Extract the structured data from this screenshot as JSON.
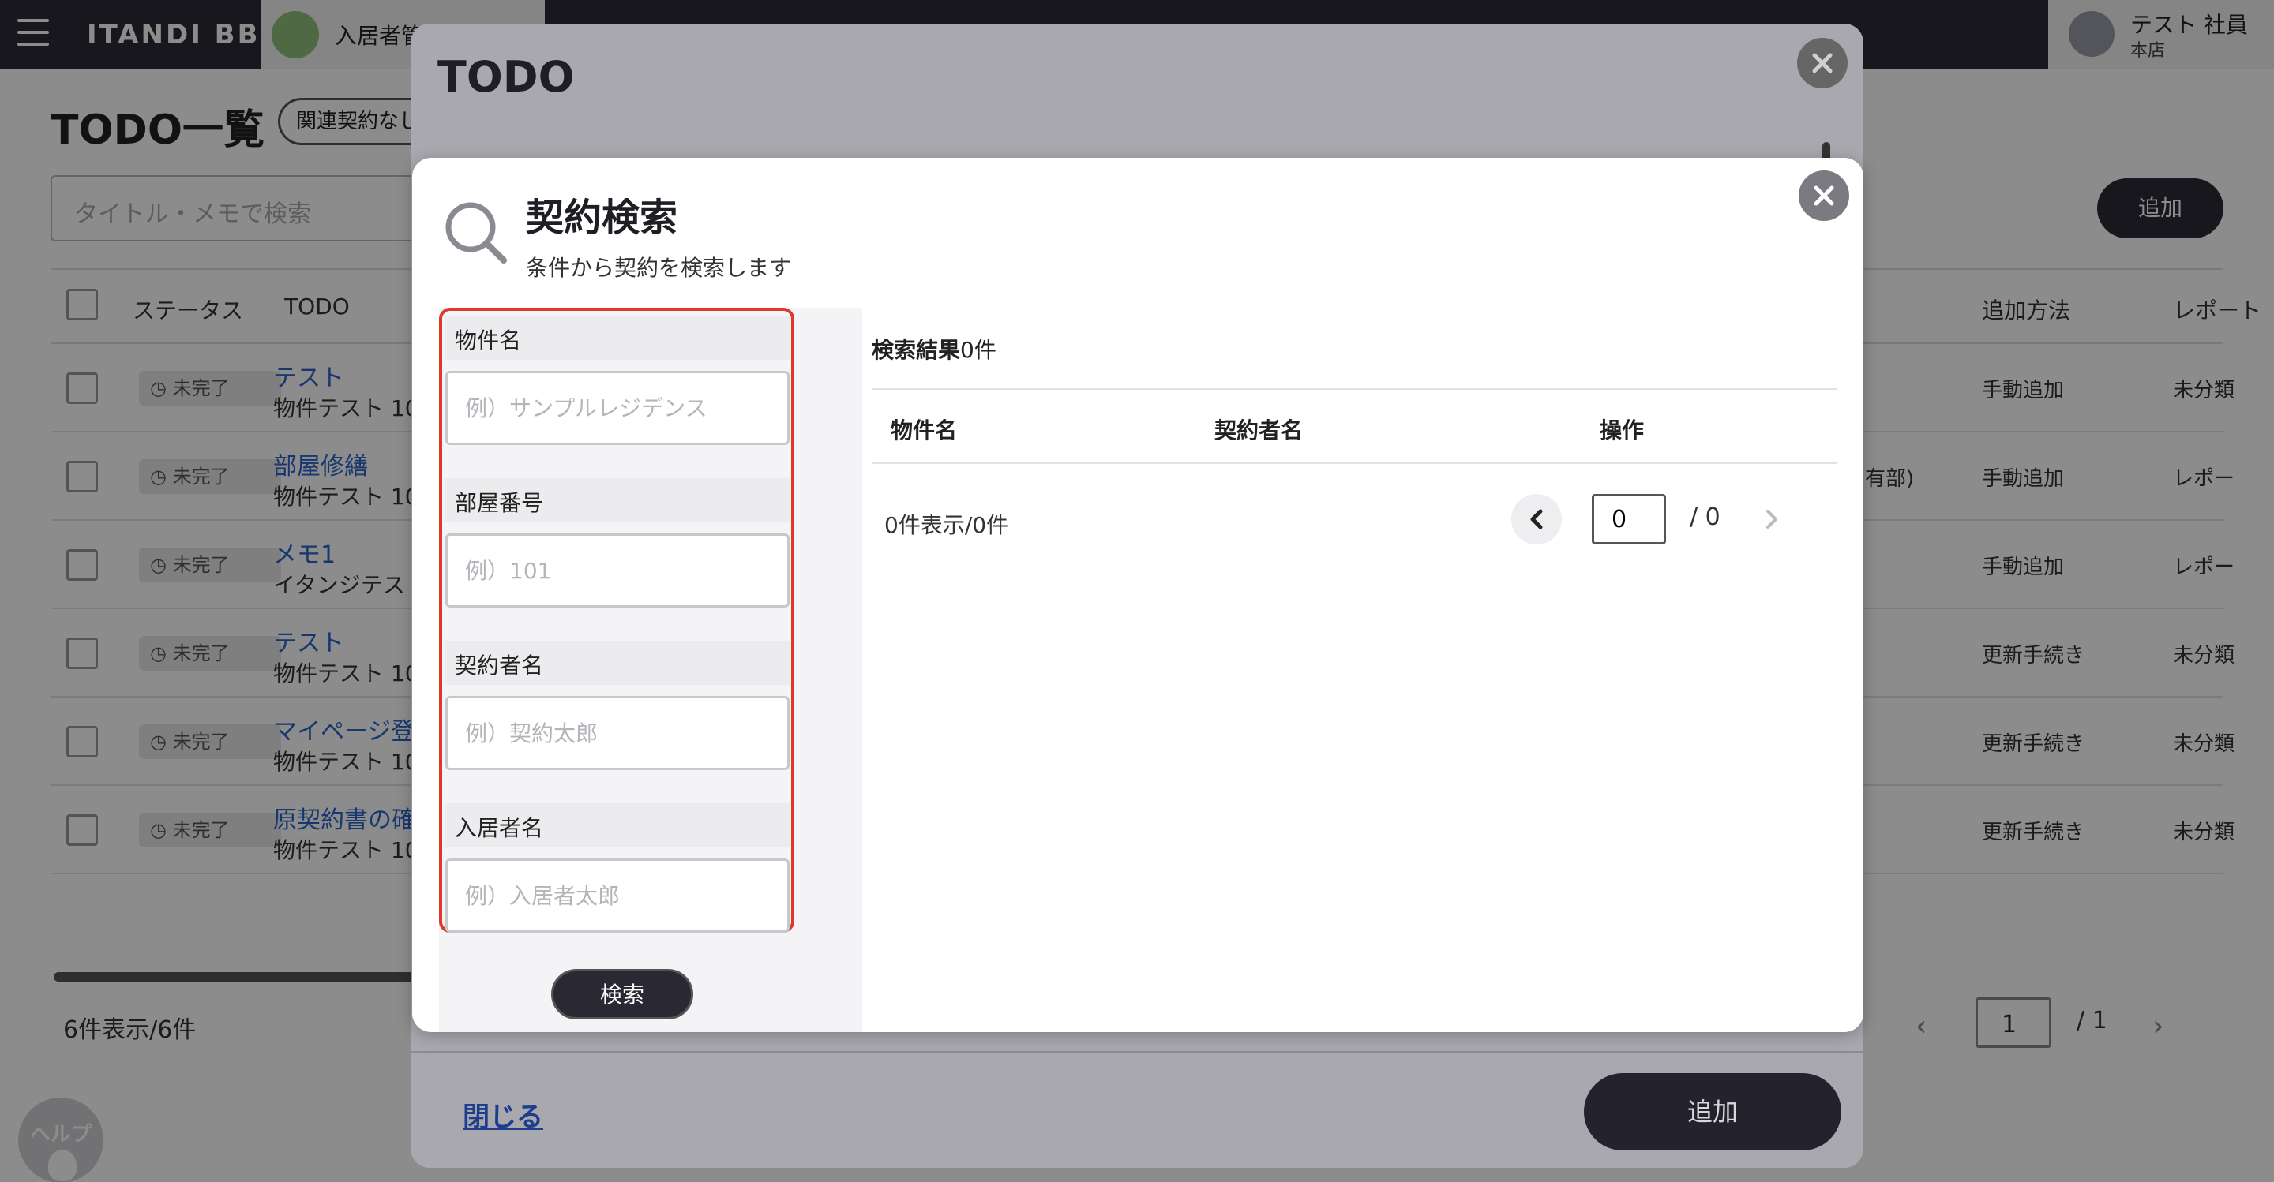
{
  "topbar": {
    "brand": "ITANDI BB",
    "app_tab_label": "入居者管",
    "user": {
      "name": "テスト 社員",
      "branch": "本店"
    }
  },
  "page": {
    "title": "TODO一覧",
    "filter_chip": "関連契約なし",
    "search_placeholder": "タイトル・メモで検索",
    "add_label": "追加",
    "columns": [
      "ステータス",
      "TODO",
      "追加方法",
      "レポート"
    ],
    "rows": [
      {
        "status": "未完了",
        "title": "テスト",
        "sub": "物件テスト 10",
        "method": "手動追加",
        "report": "未分類",
        "extra": ""
      },
      {
        "status": "未完了",
        "title": "部屋修繕",
        "sub": "物件テスト 10",
        "method": "手動追加",
        "report": "レポー",
        "extra": "有部)"
      },
      {
        "status": "未完了",
        "title": "メモ1",
        "sub": "イタンジテスト",
        "method": "手動追加",
        "report": "レポー",
        "extra": ""
      },
      {
        "status": "未完了",
        "title": "テスト",
        "sub": "物件テスト 10",
        "method": "更新手続き",
        "report": "未分類",
        "extra": ""
      },
      {
        "status": "未完了",
        "title": "マイページ登録",
        "sub": "物件テスト 10",
        "method": "更新手続き",
        "report": "未分類",
        "extra": ""
      },
      {
        "status": "未完了",
        "title": "原契約書の確認",
        "sub": "物件テスト 10",
        "method": "更新手続き",
        "report": "未分類",
        "extra": ""
      }
    ],
    "count_text": "6件表示/6件",
    "pager": {
      "current": "1",
      "total": "/ 1"
    },
    "help_label": "ヘルプ"
  },
  "todo_modal": {
    "title": "TODO",
    "close_link": "閉じる",
    "add_button": "追加"
  },
  "search_dialog": {
    "title": "契約検索",
    "subtitle": "条件から契約を検索します",
    "fields": [
      {
        "label": "物件名",
        "placeholder": "例）サンプルレジデンス"
      },
      {
        "label": "部屋番号",
        "placeholder": "例）101"
      },
      {
        "label": "契約者名",
        "placeholder": "例）契約太郎"
      },
      {
        "label": "入居者名",
        "placeholder": "例）入居者太郎"
      }
    ],
    "search_button": "検索",
    "results_label": "検索結果",
    "results_count": "0件",
    "result_columns": [
      "物件名",
      "契約者名",
      "操作"
    ],
    "display_count": "0件表示/0件",
    "pager": {
      "current": "0",
      "total": "/ 0"
    }
  },
  "colors": {
    "highlight": "#e0392b",
    "primary_dark": "#2a2832",
    "link": "#2a64c8"
  }
}
